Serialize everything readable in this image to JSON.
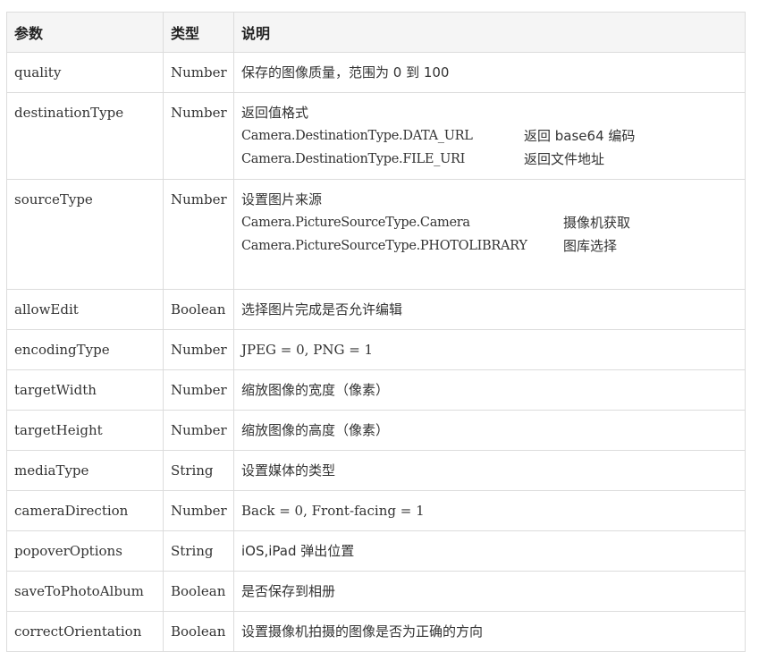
{
  "table": {
    "headers": {
      "param": "参数",
      "type": "类型",
      "desc": "说明"
    },
    "rows": [
      {
        "param": "quality",
        "type": "Number",
        "desc": "保存的图像质量，范围为 0 到 100"
      },
      {
        "param": "destinationType",
        "type": "Number",
        "desc": "返回值格式",
        "sub": [
          {
            "code": "Camera.DestinationType.DATA_URL",
            "text": "返回 base64 编码"
          },
          {
            "code": "Camera.DestinationType.FILE_URI",
            "text": "返回文件地址"
          }
        ]
      },
      {
        "param": "sourceType",
        "type": "Number",
        "desc": "设置图片来源",
        "sub": [
          {
            "code": "Camera.PictureSourceType.Camera",
            "text": "摄像机获取"
          },
          {
            "code": "Camera.PictureSourceType.PHOTOLIBRARY",
            "text": "图库选择"
          }
        ]
      },
      {
        "param": "allowEdit",
        "type": "Boolean",
        "desc": "选择图片完成是否允许编辑"
      },
      {
        "param": "encodingType",
        "type": "Number",
        "desc": "JPEG = 0, PNG = 1"
      },
      {
        "param": "targetWidth",
        "type": "Number",
        "desc": "缩放图像的宽度（像素）"
      },
      {
        "param": "targetHeight",
        "type": "Number",
        "desc": "缩放图像的高度（像素）"
      },
      {
        "param": "mediaType",
        "type": "String",
        "desc": "设置媒体的类型"
      },
      {
        "param": "cameraDirection",
        "type": "Number",
        "desc": "Back = 0, Front-facing = 1"
      },
      {
        "param": "popoverOptions",
        "type": "String",
        "desc": "iOS,iPad 弹出位置"
      },
      {
        "param": "saveToPhotoAlbum",
        "type": "Boolean",
        "desc": "是否保存到相册"
      },
      {
        "param": "correctOrientation",
        "type": "Boolean",
        "desc": "设置摄像机拍摄的图像是否为正确的方向"
      }
    ]
  }
}
